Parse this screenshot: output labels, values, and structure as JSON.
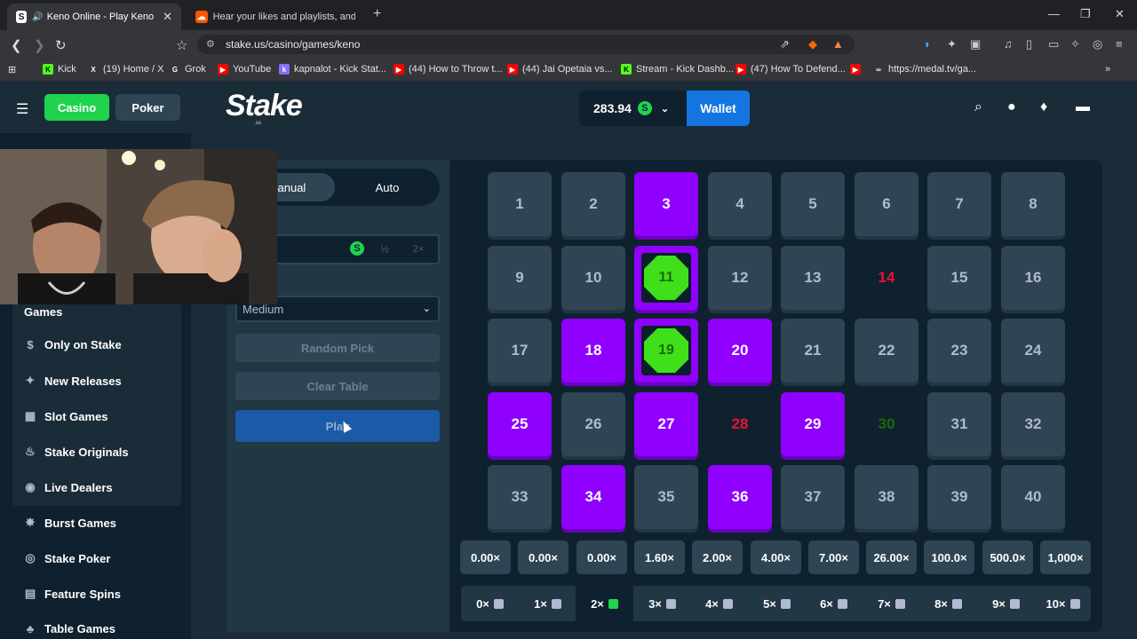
{
  "browser": {
    "tabs": [
      {
        "title": "Keno Online - Play Keno Gam",
        "active": true
      },
      {
        "title": "Hear your likes and playlists, and tra",
        "active": false
      }
    ],
    "url": "stake.us/casino/games/keno",
    "bookmarks": [
      "Kick",
      "(19) Home / X",
      "Grok",
      "YouTube",
      "kapnalot - Kick Stat...",
      "(44) How to Throw t...",
      "(44) Jai Opetaia vs...",
      "Stream - Kick Dashb...",
      "(47) How To Defend...",
      "https://medal.tv/ga..."
    ]
  },
  "header": {
    "casino": "Casino",
    "poker": "Poker",
    "logo": "Stake",
    "logo_sub": ".us",
    "balance": "283.94",
    "coin": "S",
    "wallet": "Wallet"
  },
  "sidebar": {
    "heading": "Games",
    "items": [
      "Only on Stake",
      "New Releases",
      "Slot Games",
      "Stake Originals",
      "Live Dealers",
      "Burst Games",
      "Stake Poker",
      "Feature Spins",
      "Table Games"
    ]
  },
  "controls": {
    "manual": "Manual",
    "auto": "Auto",
    "half": "½",
    "double": "2×",
    "risk": "Medium",
    "random_pick": "Random Pick",
    "clear_table": "Clear Table",
    "play": "Play"
  },
  "board": {
    "numbers": [
      "1",
      "2",
      "3",
      "4",
      "5",
      "6",
      "7",
      "8",
      "9",
      "10",
      "11",
      "12",
      "13",
      "14",
      "15",
      "16",
      "17",
      "18",
      "19",
      "20",
      "21",
      "22",
      "23",
      "24",
      "25",
      "26",
      "27",
      "28",
      "29",
      "30",
      "31",
      "32",
      "33",
      "34",
      "35",
      "36",
      "37",
      "38",
      "39",
      "40"
    ],
    "selected": [
      3,
      18,
      20,
      25,
      27,
      29,
      34,
      36
    ],
    "hits": [
      11,
      19
    ],
    "drawn_misses": [
      14,
      28,
      30
    ]
  },
  "multipliers": [
    "0.00×",
    "0.00×",
    "0.00×",
    "1.60×",
    "2.00×",
    "4.00×",
    "7.00×",
    "26.00×",
    "100.0×",
    "500.0×",
    "1,000×"
  ],
  "hit_counts": [
    "0×",
    "1×",
    "2×",
    "3×",
    "4×",
    "5×",
    "6×",
    "7×",
    "8×",
    "9×",
    "10×"
  ],
  "active_hit_index": 2,
  "colors": {
    "accent_green": "#1fd34d",
    "selected_purple": "#9000ff",
    "wallet_blue": "#1475e1",
    "gem_green": "#3fe01a"
  }
}
